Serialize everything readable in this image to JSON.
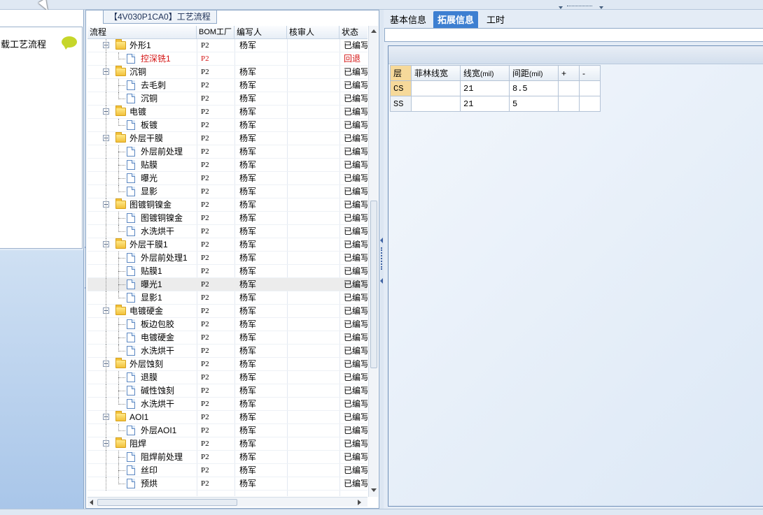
{
  "left_panel": {
    "title": "加载工艺流程"
  },
  "process_panel": {
    "tab_label": "【4V030P1CA0】工艺流程",
    "columns": {
      "flow": "流程",
      "bom_factory": "BOM工厂",
      "author": "编写人",
      "reviewer": "核审人",
      "status": "状态"
    },
    "rows": [
      {
        "name": "外形1",
        "level": 1,
        "bom": "P2",
        "author": "杨军",
        "reviewer": "",
        "status": "已编写",
        "highlight": false
      },
      {
        "name": "控深铣1",
        "level": 2,
        "bom": "P2",
        "author": "",
        "reviewer": "",
        "status": "回退",
        "highlight": true
      },
      {
        "name": "沉铜",
        "level": 1,
        "bom": "P2",
        "author": "杨军",
        "reviewer": "",
        "status": "已编写",
        "highlight": false
      },
      {
        "name": "去毛刺",
        "level": 2,
        "bom": "P2",
        "author": "杨军",
        "reviewer": "",
        "status": "已编写",
        "highlight": false
      },
      {
        "name": "沉铜",
        "level": 2,
        "bom": "P2",
        "author": "杨军",
        "reviewer": "",
        "status": "已编写",
        "highlight": false
      },
      {
        "name": "电镀",
        "level": 1,
        "bom": "P2",
        "author": "杨军",
        "reviewer": "",
        "status": "已编写",
        "highlight": false
      },
      {
        "name": "板镀",
        "level": 2,
        "bom": "P2",
        "author": "杨军",
        "reviewer": "",
        "status": "已编写",
        "highlight": false
      },
      {
        "name": "外层干膜",
        "level": 1,
        "bom": "P2",
        "author": "杨军",
        "reviewer": "",
        "status": "已编写",
        "highlight": false
      },
      {
        "name": "外层前处理",
        "level": 2,
        "bom": "P2",
        "author": "杨军",
        "reviewer": "",
        "status": "已编写",
        "highlight": false
      },
      {
        "name": "贴膜",
        "level": 2,
        "bom": "P2",
        "author": "杨军",
        "reviewer": "",
        "status": "已编写",
        "highlight": false
      },
      {
        "name": "曝光",
        "level": 2,
        "bom": "P2",
        "author": "杨军",
        "reviewer": "",
        "status": "已编写",
        "highlight": false
      },
      {
        "name": "显影",
        "level": 2,
        "bom": "P2",
        "author": "杨军",
        "reviewer": "",
        "status": "已编写",
        "highlight": false
      },
      {
        "name": "图镀铜镍金",
        "level": 1,
        "bom": "P2",
        "author": "杨军",
        "reviewer": "",
        "status": "已编写",
        "highlight": false
      },
      {
        "name": "图镀铜镍金",
        "level": 2,
        "bom": "P2",
        "author": "杨军",
        "reviewer": "",
        "status": "已编写",
        "highlight": false
      },
      {
        "name": "水洗烘干",
        "level": 2,
        "bom": "P2",
        "author": "杨军",
        "reviewer": "",
        "status": "已编写",
        "highlight": false
      },
      {
        "name": "外层干膜1",
        "level": 1,
        "bom": "P2",
        "author": "杨军",
        "reviewer": "",
        "status": "已编写",
        "highlight": false
      },
      {
        "name": "外层前处理1",
        "level": 2,
        "bom": "P2",
        "author": "杨军",
        "reviewer": "",
        "status": "已编写",
        "highlight": false
      },
      {
        "name": "贴膜1",
        "level": 2,
        "bom": "P2",
        "author": "杨军",
        "reviewer": "",
        "status": "已编写",
        "highlight": false
      },
      {
        "name": "曝光1",
        "level": 2,
        "bom": "P2",
        "author": "杨军",
        "reviewer": "",
        "status": "已编写",
        "highlight": false,
        "selected": true
      },
      {
        "name": "显影1",
        "level": 2,
        "bom": "P2",
        "author": "杨军",
        "reviewer": "",
        "status": "已编写",
        "highlight": false
      },
      {
        "name": "电镀硬金",
        "level": 1,
        "bom": "P2",
        "author": "杨军",
        "reviewer": "",
        "status": "已编写",
        "highlight": false
      },
      {
        "name": "板边包胶",
        "level": 2,
        "bom": "P2",
        "author": "杨军",
        "reviewer": "",
        "status": "已编写",
        "highlight": false
      },
      {
        "name": "电镀硬金",
        "level": 2,
        "bom": "P2",
        "author": "杨军",
        "reviewer": "",
        "status": "已编写",
        "highlight": false
      },
      {
        "name": "水洗烘干",
        "level": 2,
        "bom": "P2",
        "author": "杨军",
        "reviewer": "",
        "status": "已编写",
        "highlight": false
      },
      {
        "name": "外层蚀刻",
        "level": 1,
        "bom": "P2",
        "author": "杨军",
        "reviewer": "",
        "status": "已编写",
        "highlight": false
      },
      {
        "name": "退膜",
        "level": 2,
        "bom": "P2",
        "author": "杨军",
        "reviewer": "",
        "status": "已编写",
        "highlight": false
      },
      {
        "name": "碱性蚀刻",
        "level": 2,
        "bom": "P2",
        "author": "杨军",
        "reviewer": "",
        "status": "已编写",
        "highlight": false
      },
      {
        "name": "水洗烘干",
        "level": 2,
        "bom": "P2",
        "author": "杨军",
        "reviewer": "",
        "status": "已编写",
        "highlight": false
      },
      {
        "name": "AOI1",
        "level": 1,
        "bom": "P2",
        "author": "杨军",
        "reviewer": "",
        "status": "已编写",
        "highlight": false
      },
      {
        "name": "外层AOI1",
        "level": 2,
        "bom": "P2",
        "author": "杨军",
        "reviewer": "",
        "status": "已编写",
        "highlight": false
      },
      {
        "name": "阻焊",
        "level": 1,
        "bom": "P2",
        "author": "杨军",
        "reviewer": "",
        "status": "已编写",
        "highlight": false
      },
      {
        "name": "阻焊前处理",
        "level": 2,
        "bom": "P2",
        "author": "杨军",
        "reviewer": "",
        "status": "已编写",
        "highlight": false
      },
      {
        "name": "丝印",
        "level": 2,
        "bom": "P2",
        "author": "杨军",
        "reviewer": "",
        "status": "已编写",
        "highlight": false
      },
      {
        "name": "预烘",
        "level": 2,
        "bom": "P2",
        "author": "杨军",
        "reviewer": "",
        "status": "已编写",
        "highlight": false
      }
    ]
  },
  "detail_panel": {
    "tabs": [
      {
        "label": "基本信息",
        "active": false
      },
      {
        "label": "拓展信息",
        "active": true
      },
      {
        "label": "工时",
        "active": false
      }
    ],
    "layer_table": {
      "headers": {
        "layer": "层",
        "feilin": "菲林线宽",
        "width": "线宽",
        "width_unit": "(mil)",
        "spacing": "间距",
        "spacing_unit": "(mil)",
        "add": "+",
        "remove": "-"
      },
      "rows": [
        {
          "layer": "CS",
          "feilin": "",
          "width": "21",
          "spacing": "8.5"
        },
        {
          "layer": "SS",
          "feilin": "",
          "width": "21",
          "spacing": "5"
        }
      ]
    }
  },
  "colors": {
    "accent": "#3d7fd1",
    "rollback_text": "#d41414",
    "layer_highlight": "#f6d99a"
  }
}
